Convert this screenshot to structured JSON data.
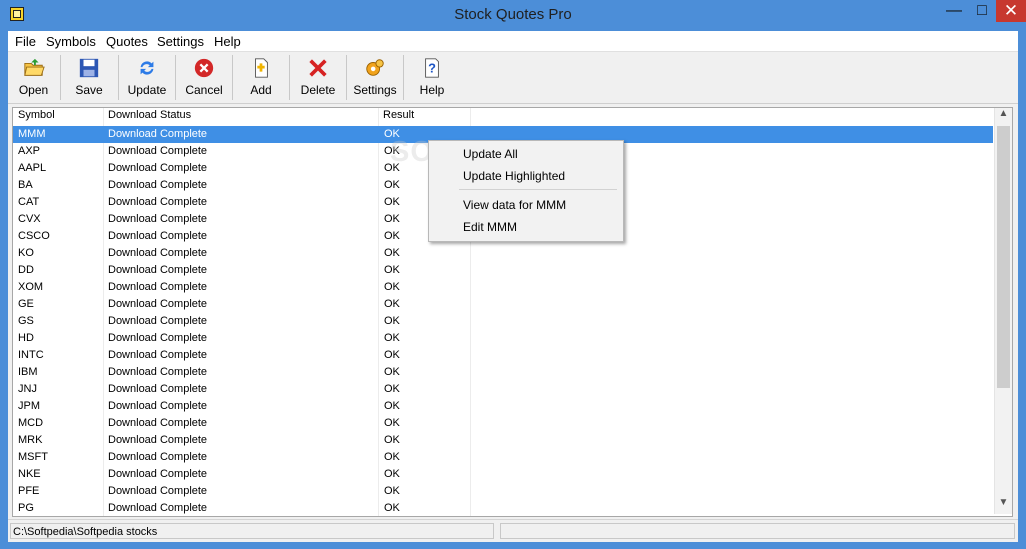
{
  "window": {
    "title": "Stock Quotes Pro",
    "controls": {
      "minimize": "—",
      "maximize": "□",
      "close": "✕"
    }
  },
  "menu": [
    "File",
    "Symbols",
    "Quotes",
    "Settings",
    "Help"
  ],
  "toolbar": [
    {
      "label": "Open",
      "icon": "folder-open-icon"
    },
    {
      "label": "Save",
      "icon": "save-icon"
    },
    {
      "label": "Update",
      "icon": "refresh-icon"
    },
    {
      "label": "Cancel",
      "icon": "cancel-icon"
    },
    {
      "label": "Add",
      "icon": "add-icon"
    },
    {
      "label": "Delete",
      "icon": "delete-icon"
    },
    {
      "label": "Settings",
      "icon": "gear-icon"
    },
    {
      "label": "Help",
      "icon": "help-icon"
    }
  ],
  "table": {
    "columns": [
      "Symbol",
      "Download Status",
      "Result"
    ],
    "rows": [
      [
        "MMM",
        "Download Complete",
        "OK"
      ],
      [
        "AXP",
        "Download Complete",
        "OK"
      ],
      [
        "AAPL",
        "Download Complete",
        "OK"
      ],
      [
        "BA",
        "Download Complete",
        "OK"
      ],
      [
        "CAT",
        "Download Complete",
        "OK"
      ],
      [
        "CVX",
        "Download Complete",
        "OK"
      ],
      [
        "CSCO",
        "Download Complete",
        "OK"
      ],
      [
        "KO",
        "Download Complete",
        "OK"
      ],
      [
        "DD",
        "Download Complete",
        "OK"
      ],
      [
        "XOM",
        "Download Complete",
        "OK"
      ],
      [
        "GE",
        "Download Complete",
        "OK"
      ],
      [
        "GS",
        "Download Complete",
        "OK"
      ],
      [
        "HD",
        "Download Complete",
        "OK"
      ],
      [
        "INTC",
        "Download Complete",
        "OK"
      ],
      [
        "IBM",
        "Download Complete",
        "OK"
      ],
      [
        "JNJ",
        "Download Complete",
        "OK"
      ],
      [
        "JPM",
        "Download Complete",
        "OK"
      ],
      [
        "MCD",
        "Download Complete",
        "OK"
      ],
      [
        "MRK",
        "Download Complete",
        "OK"
      ],
      [
        "MSFT",
        "Download Complete",
        "OK"
      ],
      [
        "NKE",
        "Download Complete",
        "OK"
      ],
      [
        "PFE",
        "Download Complete",
        "OK"
      ],
      [
        "PG",
        "Download Complete",
        "OK"
      ]
    ]
  },
  "context_menu": [
    "Update All",
    "Update Highlighted",
    "View data for MMM",
    "Edit MMM"
  ],
  "status": {
    "path": "C:\\Softpedia\\Softpedia stocks"
  },
  "watermark": "SOFTPEDIA",
  "colors": {
    "titlebar": "#4c8ed8",
    "selection": "#3f8fe5",
    "close": "#c7382f"
  }
}
